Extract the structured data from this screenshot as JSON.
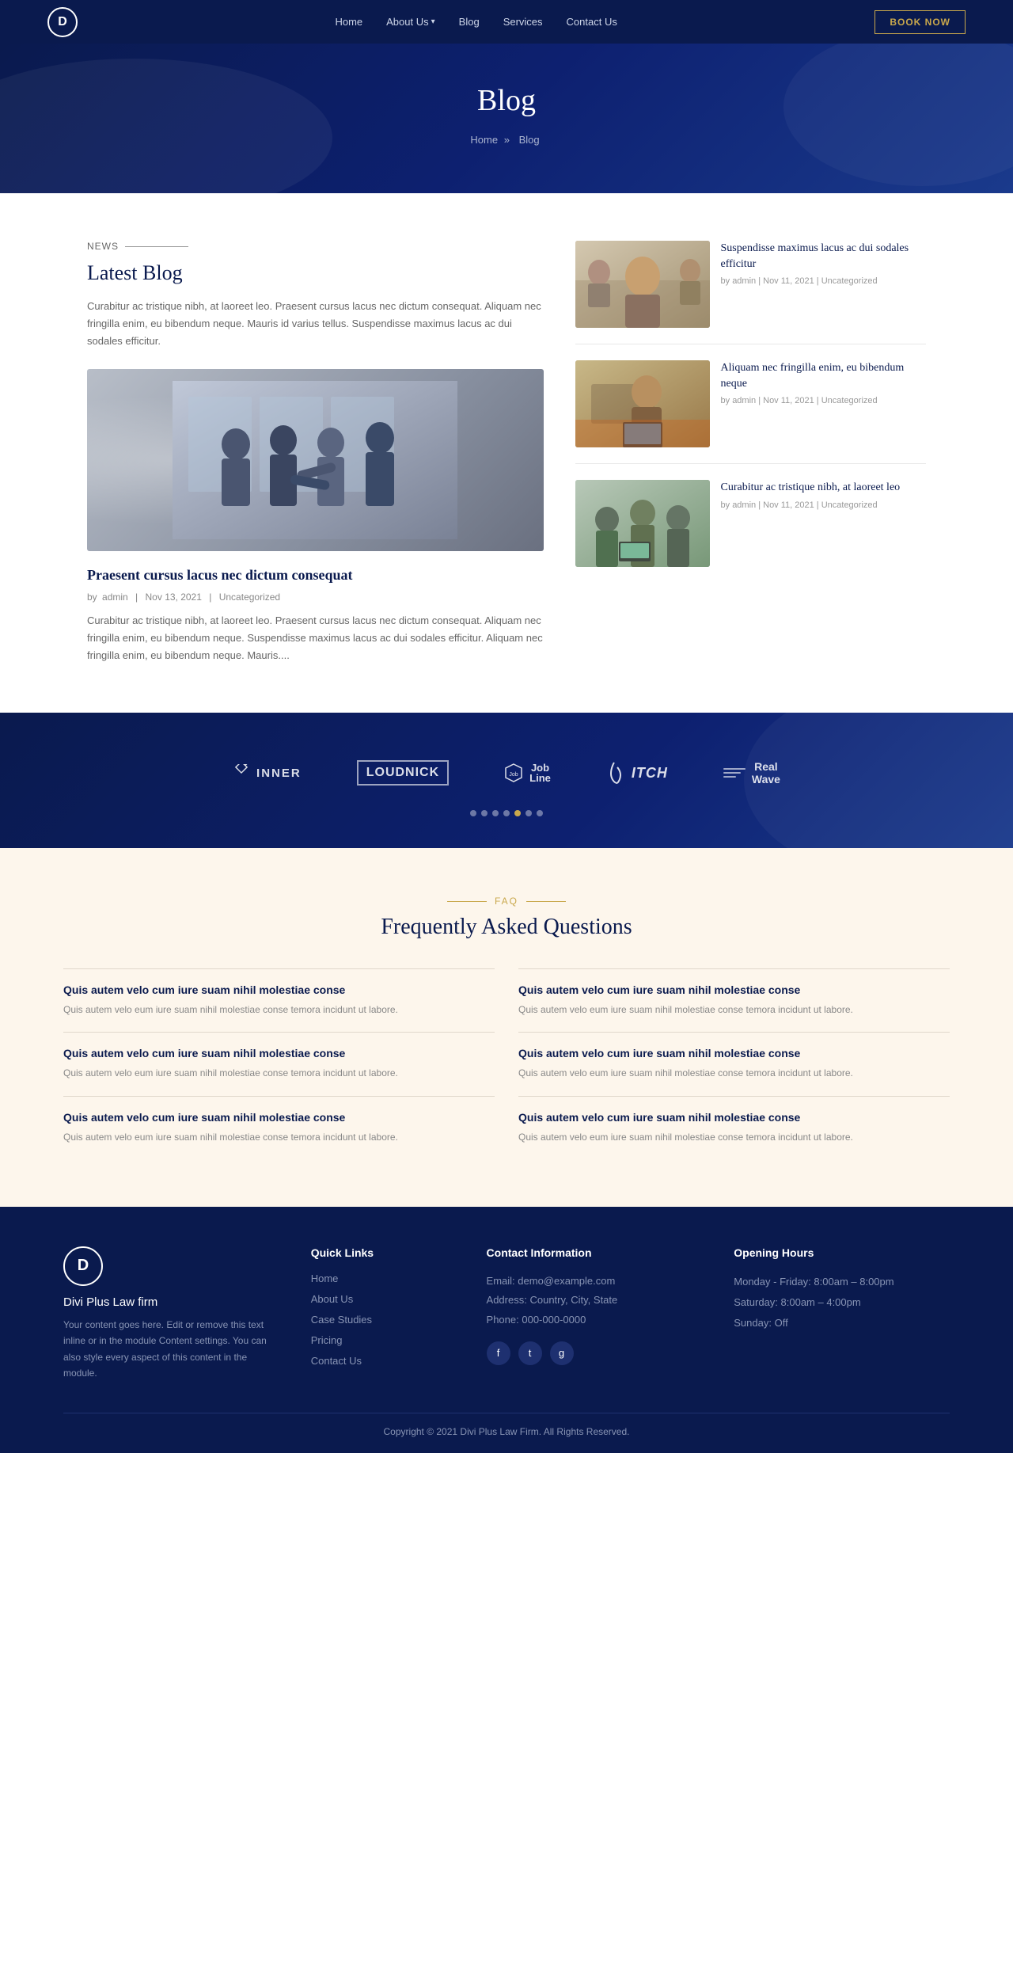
{
  "navbar": {
    "logo_letter": "D",
    "links": [
      {
        "label": "Home",
        "href": "#",
        "has_dropdown": false
      },
      {
        "label": "About Us",
        "href": "#",
        "has_dropdown": true
      },
      {
        "label": "Blog",
        "href": "#",
        "has_dropdown": false
      },
      {
        "label": "Services",
        "href": "#",
        "has_dropdown": false
      },
      {
        "label": "Contact Us",
        "href": "#",
        "has_dropdown": false
      }
    ],
    "book_button": "BOOK NOW"
  },
  "hero": {
    "title": "Blog",
    "breadcrumb_home": "Home",
    "breadcrumb_current": "Blog",
    "separator": "»"
  },
  "blog": {
    "news_label": "News",
    "section_title": "Latest Blog",
    "section_desc": "Curabitur ac tristique nibh, at laoreet leo. Praesent cursus lacus nec dictum consequat. Aliquam nec fringilla enim, eu bibendum neque. Mauris id varius tellus. Suspendisse maximus lacus ac dui sodales efficitur.",
    "featured_article": {
      "title": "Praesent cursus lacus nec dictum consequat",
      "meta_author": "admin",
      "meta_date": "Nov 13, 2021",
      "meta_category": "Uncategorized",
      "excerpt": "Curabitur ac tristique nibh, at laoreet leo. Praesent cursus lacus nec dictum consequat. Aliquam nec fringilla enim, eu bibendum neque. Suspendisse maximus lacus ac dui sodales efficitur. Aliquam nec fringilla enim, eu bibendum neque. Mauris...."
    },
    "sidebar_articles": [
      {
        "title": "Suspendisse maximus lacus ac dui sodales efficitur",
        "meta": "by admin | Nov 11, 2021 | Uncategorized",
        "thumb_class": "thumb-1"
      },
      {
        "title": "Aliquam nec fringilla enim, eu bibendum neque",
        "meta": "by admin | Nov 11, 2021 | Uncategorized",
        "thumb_class": "thumb-2"
      },
      {
        "title": "Curabitur ac tristique nibh, at laoreet leo",
        "meta": "by admin | Nov 11, 2021 | Uncategorized",
        "thumb_class": "thumb-3"
      }
    ]
  },
  "brands": {
    "logos": [
      {
        "name": "INNER",
        "class": "inner"
      },
      {
        "name": "LOUDNICK",
        "class": "loudnick"
      },
      {
        "name": "Job Line",
        "class": "jobline"
      },
      {
        "name": "ITCH",
        "class": "itch"
      },
      {
        "name": "Real Wave",
        "class": "realwave"
      }
    ],
    "dots": [
      false,
      false,
      false,
      false,
      true,
      false,
      false
    ]
  },
  "faq": {
    "section_label": "FAQ",
    "section_title": "Frequently Asked Questions",
    "items": [
      {
        "question": "Quis autem velo cum iure suam nihil molestiae conse",
        "answer": "Quis autem velo eum iure suam nihil molestiae conse temora incidunt ut labore."
      },
      {
        "question": "Quis autem velo cum iure suam nihil molestiae conse",
        "answer": "Quis autem velo eum iure suam nihil molestiae conse temora incidunt ut labore."
      },
      {
        "question": "Quis autem velo cum iure suam nihil molestiae conse",
        "answer": "Quis autem velo eum iure suam nihil molestiae conse temora incidunt ut labore."
      },
      {
        "question": "Quis autem velo cum iure suam nihil molestiae conse",
        "answer": "Quis autem velo eum iure suam nihil molestiae conse temora incidunt ut labore."
      },
      {
        "question": "Quis autem velo cum iure suam nihil molestiae conse",
        "answer": "Quis autem velo eum iure suam nihil molestiae conse temora incidunt ut labore."
      },
      {
        "question": "Quis autem velo cum iure suam nihil molestiae conse",
        "answer": "Quis autem velo eum iure suam nihil molestiae conse temora incidunt ut labore."
      }
    ]
  },
  "footer": {
    "logo_letter": "D",
    "company_name": "Divi Plus Law firm",
    "company_desc": "Your content goes here. Edit or remove this text inline or in the module Content settings. You can also style every aspect of this content in the module.",
    "quick_links_title": "Quick Links",
    "quick_links": [
      {
        "label": "Home",
        "href": "#"
      },
      {
        "label": "About Us",
        "href": "#"
      },
      {
        "label": "Case Studies",
        "href": "#"
      },
      {
        "label": "Pricing",
        "href": "#"
      },
      {
        "label": "Contact Us",
        "href": "#"
      }
    ],
    "contact_title": "Contact Information",
    "contact_email_label": "Email:",
    "contact_email": "demo@example.com",
    "contact_address_label": "Address:",
    "contact_address": "Country, City, State",
    "contact_phone_label": "Phone:",
    "contact_phone": "000-000-0000",
    "social_icons": [
      "f",
      "t",
      "g"
    ],
    "hours_title": "Opening Hours",
    "hours": [
      "Monday - Friday: 8:00am – 8:00pm",
      "Saturday: 8:00am – 4:00pm",
      "Sunday: Off"
    ],
    "copyright": "Copyright © 2021 Divi Plus Law Firm. All Rights Reserved."
  }
}
